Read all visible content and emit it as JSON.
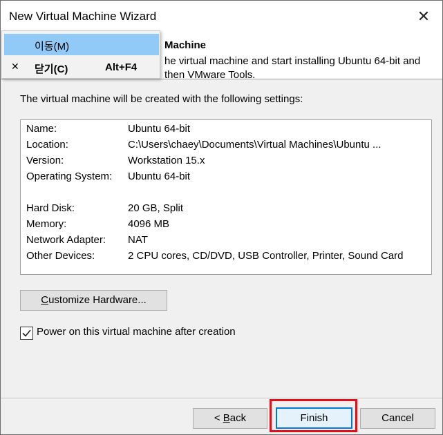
{
  "window": {
    "title": "New Virtual Machine Wizard",
    "close_glyph": "✕"
  },
  "header": {
    "title": "Machine",
    "subtitle": "he virtual machine and start installing Ubuntu 64-bit and then VMware Tools."
  },
  "intro": "The virtual machine will be created with the following settings:",
  "settings": [
    {
      "key": "Name:",
      "value": "Ubuntu 64-bit"
    },
    {
      "key": "Location:",
      "value": "C:\\Users\\chaey\\Documents\\Virtual Machines\\Ubuntu ..."
    },
    {
      "key": "Version:",
      "value": "Workstation 15.x"
    },
    {
      "key": "Operating System:",
      "value": "Ubuntu 64-bit"
    },
    {
      "key": "Hard Disk:",
      "value": "20 GB, Split"
    },
    {
      "key": "Memory:",
      "value": "4096 MB"
    },
    {
      "key": "Network Adapter:",
      "value": "NAT"
    },
    {
      "key": "Other Devices:",
      "value": "2 CPU cores, CD/DVD, USB Controller, Printer, Sound Card"
    }
  ],
  "customize_button": {
    "pre": "",
    "mnemonic": "C",
    "post": "ustomize Hardware..."
  },
  "power_on": {
    "label": "Power on this virtual machine after creation",
    "checked": true
  },
  "buttons": {
    "back": {
      "pre": "< ",
      "mnemonic": "B",
      "post": "ack"
    },
    "finish": "Finish",
    "cancel": "Cancel"
  },
  "system_menu": {
    "items": [
      {
        "icon": "",
        "label": "이동(M)",
        "shortcut": ""
      },
      {
        "icon": "✕",
        "label": "닫기(C)",
        "shortcut": "Alt+F4"
      }
    ]
  },
  "colors": {
    "highlight": "#e0101a",
    "menu_active": "#91c9f7",
    "default_button_border": "#0078d7"
  }
}
